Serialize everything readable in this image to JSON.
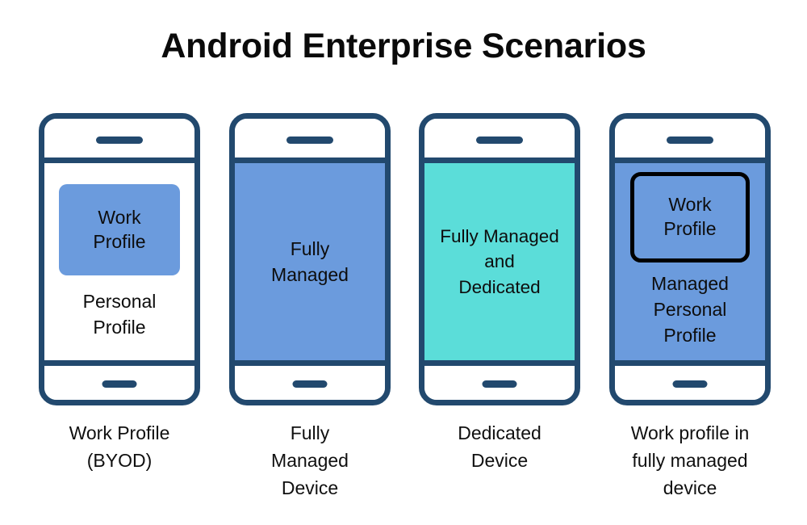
{
  "title": "Android Enterprise Scenarios",
  "colors": {
    "frame": "#22496E",
    "work_blue": "#6B9BDD",
    "dedicated_cyan": "#5BDDD9",
    "outline_black": "#000000",
    "background": "#FFFFFF",
    "text": "#0D0D0D"
  },
  "scenarios": [
    {
      "id": "work-profile-byod",
      "screen_fill": "white",
      "work_box": {
        "style": "filled",
        "label": "Work\nProfile"
      },
      "screen_text": "Personal\nProfile",
      "caption": "Work Profile\n(BYOD)"
    },
    {
      "id": "fully-managed-device",
      "screen_fill": "blue",
      "work_box": null,
      "screen_text": "Fully\nManaged",
      "caption": "Fully\nManaged\nDevice"
    },
    {
      "id": "dedicated-device",
      "screen_fill": "cyan",
      "work_box": null,
      "screen_text": "Fully Managed\nand\nDedicated",
      "caption": "Dedicated\nDevice"
    },
    {
      "id": "work-profile-in-fully-managed-device",
      "screen_fill": "blue",
      "work_box": {
        "style": "outlined",
        "label": "Work\nProfile"
      },
      "screen_text": "Managed\nPersonal\nProfile",
      "caption": "Work  profile in\nfully managed\ndevice"
    }
  ]
}
